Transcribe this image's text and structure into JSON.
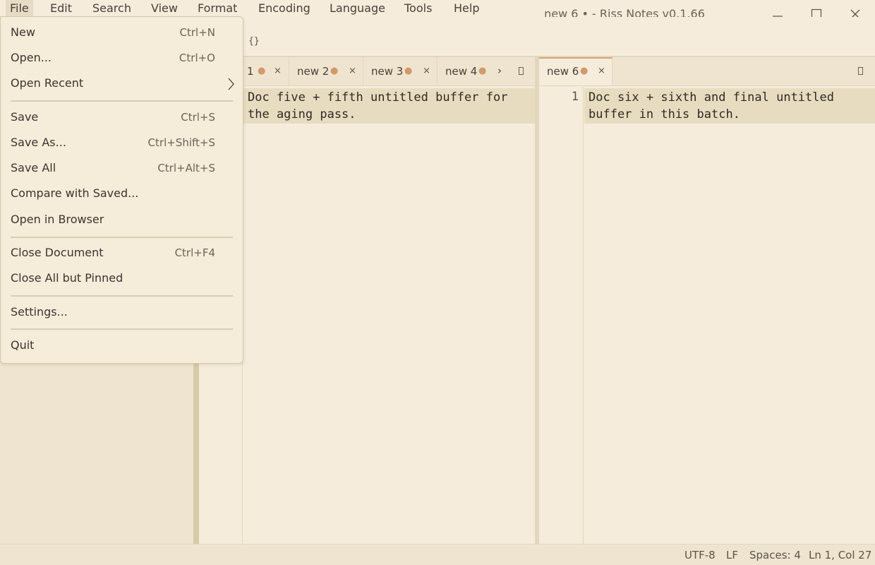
{
  "window": {
    "title": "new 6 • - Riss Notes v0.1.66"
  },
  "menubar": {
    "items": [
      "File",
      "Edit",
      "Search",
      "View",
      "Format",
      "Encoding",
      "Language",
      "Tools",
      "Help"
    ]
  },
  "toolbar": {
    "braces": "{}"
  },
  "file_menu": {
    "new": {
      "label": "New",
      "shortcut": "Ctrl+N"
    },
    "open": {
      "label": "Open...",
      "shortcut": "Ctrl+O"
    },
    "open_recent": {
      "label": "Open Recent"
    },
    "save": {
      "label": "Save",
      "shortcut": "Ctrl+S"
    },
    "save_as": {
      "label": "Save As...",
      "shortcut": "Ctrl+Shift+S"
    },
    "save_all": {
      "label": "Save All",
      "shortcut": "Ctrl+Alt+S"
    },
    "compare": {
      "label": "Compare with Saved..."
    },
    "open_browser": {
      "label": "Open in Browser"
    },
    "close_doc": {
      "label": "Close Document",
      "shortcut": "Ctrl+F4"
    },
    "close_all": {
      "label": "Close All but Pinned"
    },
    "settings": {
      "label": "Settings..."
    },
    "quit": {
      "label": "Quit"
    }
  },
  "pane_left": {
    "tabs": [
      {
        "label": "1",
        "modified": true
      },
      {
        "label": "new 2",
        "modified": true
      },
      {
        "label": "new 3",
        "modified": true
      },
      {
        "label": "new 4",
        "modified": true
      }
    ],
    "overflow_glyph": "›",
    "text": "Doc five + fifth untitled buffer for\nthe aging pass."
  },
  "pane_right": {
    "tabs": [
      {
        "label": "new 6",
        "modified": true,
        "active": true
      }
    ],
    "line_number": "1",
    "text": "Doc six + sixth and final untitled\nbuffer in this batch."
  },
  "glyphs": {
    "modified_dot": "●",
    "close": "×"
  },
  "statusbar": {
    "encoding": "UTF-8",
    "line_ending": "LF",
    "indent": "Spaces: 4",
    "cursor": "Ln 1, Col 27"
  },
  "colors": {
    "background": "#f5ecdb",
    "accent": "#d4a574",
    "modified_dot": "#d09a6a",
    "selection": "#e8dcc0"
  }
}
